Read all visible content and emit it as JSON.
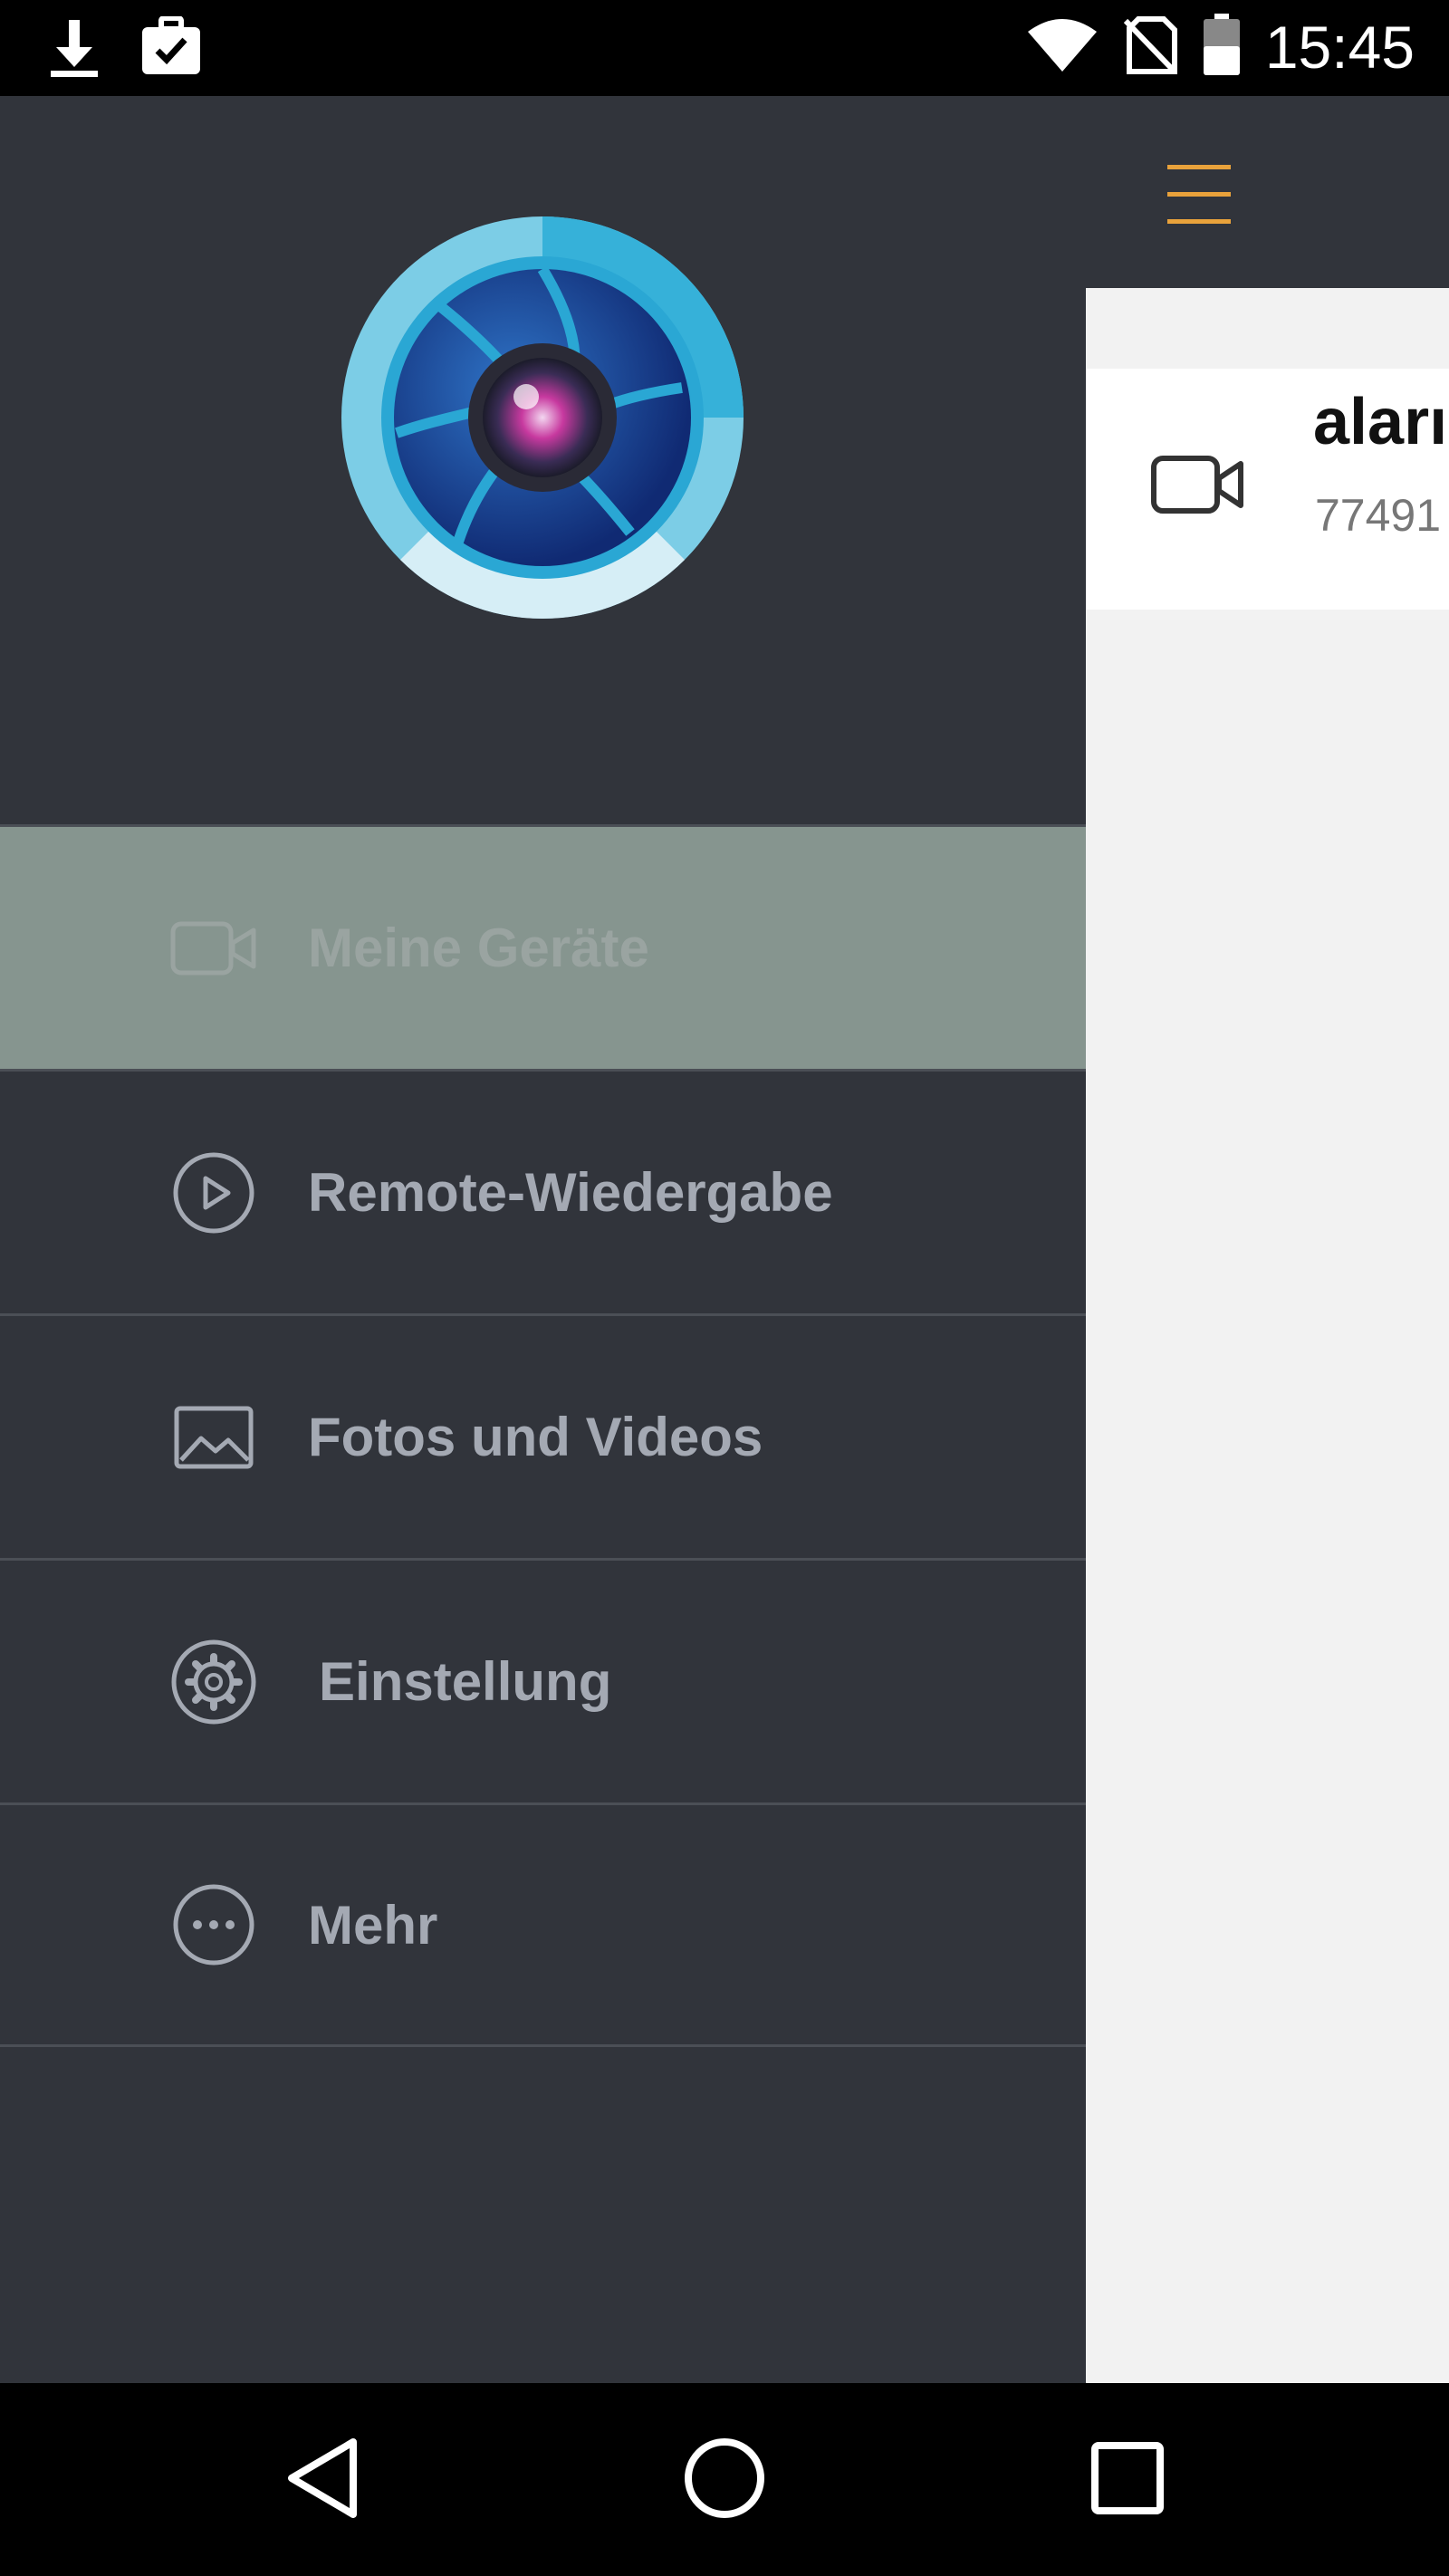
{
  "status_bar": {
    "time": "15:45",
    "icons": [
      "download-icon",
      "briefcase-check-icon",
      "wifi-icon",
      "no-sim-icon",
      "battery-icon"
    ]
  },
  "drawer": {
    "logo": "camera-aperture-logo",
    "items": [
      {
        "label": "Meine Geräte",
        "icon": "video-camera-icon",
        "active": true
      },
      {
        "label": "Remote-Wiedergabe",
        "icon": "play-circle-icon",
        "active": false
      },
      {
        "label": "Fotos und Videos",
        "icon": "image-icon",
        "active": false
      },
      {
        "label": "Einstellung",
        "icon": "gear-icon",
        "active": false
      },
      {
        "label": "Mehr",
        "icon": "more-dots-icon",
        "active": false
      }
    ]
  },
  "main": {
    "menu_icon": "hamburger-menu-icon",
    "device": {
      "name": "aları",
      "id": "77491"
    }
  },
  "colors": {
    "drawer_bg": "#31343b",
    "active_item_bg": "#86958f",
    "menu_text": "#a4a9b3",
    "accent_orange": "#e9a23b",
    "content_bg": "#f2f2f2"
  },
  "nav_bar": [
    "back-icon",
    "home-icon",
    "recents-icon"
  ]
}
